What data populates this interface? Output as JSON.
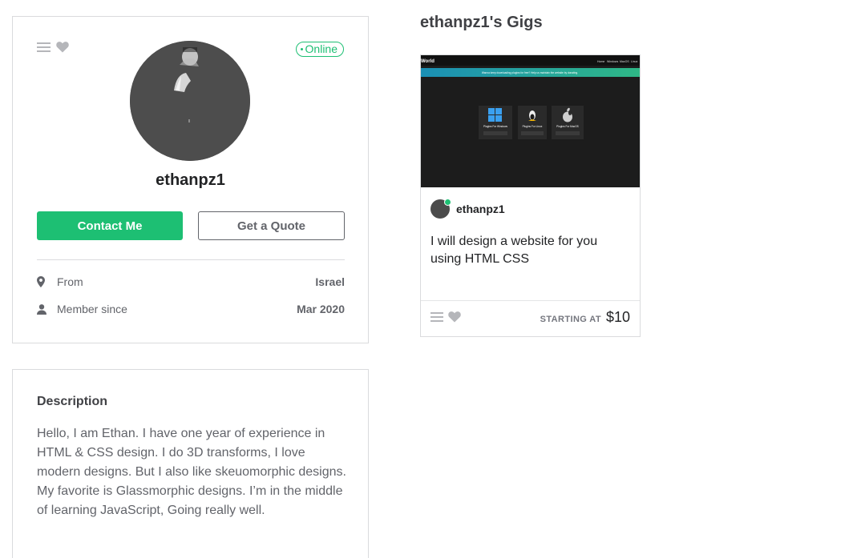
{
  "profile": {
    "status": "Online",
    "username": "ethanpz1",
    "contact_label": "Contact Me",
    "quote_label": "Get a Quote",
    "stats": {
      "from_label": "From",
      "from_value": "Israel",
      "member_label": "Member since",
      "member_value": "Mar 2020"
    },
    "icons": [
      "menu-icon",
      "heart-icon",
      "location-pin-icon",
      "user-icon"
    ]
  },
  "description": {
    "title": "Description",
    "text": "Hello, I am Ethan. I have one year of experience in HTML & CSS design. I do 3D transforms, I love modern designs. But I also like skeuomorphic designs. My favorite is Glassmorphic designs. I’m in the middle of learning JavaScript, Going really well."
  },
  "gigs": {
    "title": "ethanpz1's Gigs",
    "items": [
      {
        "thumbnail": {
          "brand": "World",
          "nav": [
            "Home",
            "Windows",
            "MacOS",
            "Linux"
          ],
          "banner": "Wanna keep downloading plugins for free? Help us maintain the website by donating.",
          "tiles": [
            "Plugins For Windows",
            "Plugins For Linux",
            "Plugins For MacOS"
          ]
        },
        "seller": "ethanpz1",
        "description": "I will design a website for you using HTML CSS",
        "price_label": "STARTING AT",
        "price": "$10"
      }
    ]
  },
  "colors": {
    "accent": "#1dbf73",
    "border": "#dadbdd",
    "text": "#404145",
    "muted": "#62646a"
  }
}
